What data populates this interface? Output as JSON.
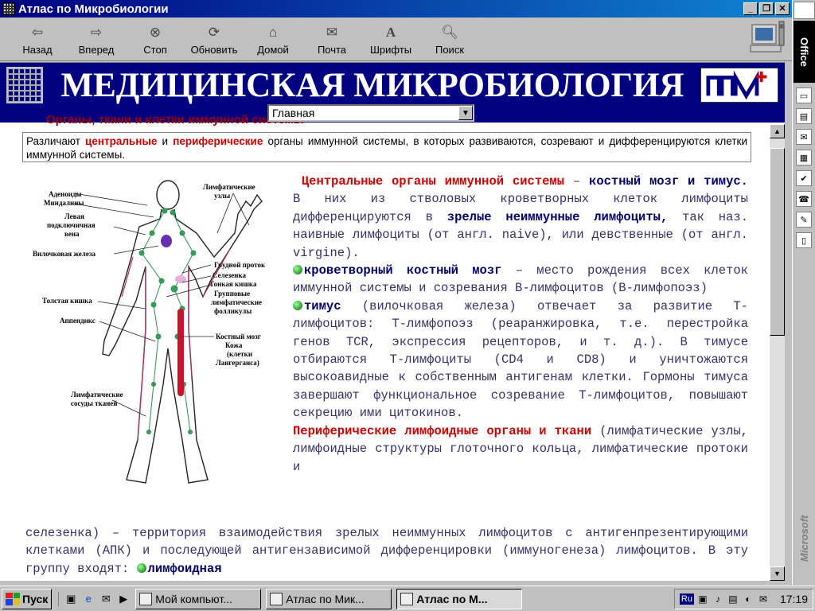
{
  "window": {
    "title": "Атлас по Микробиологии"
  },
  "toolbar": {
    "buttons": [
      {
        "label": "Назад",
        "icon": "arrow-left-icon"
      },
      {
        "label": "Вперед",
        "icon": "arrow-right-icon"
      },
      {
        "label": "Стоп",
        "icon": "stop-icon"
      },
      {
        "label": "Обновить",
        "icon": "refresh-icon"
      },
      {
        "label": "Домой",
        "icon": "home-icon"
      },
      {
        "label": "Почта",
        "icon": "mail-icon"
      },
      {
        "label": "Шрифты",
        "icon": "font-icon"
      },
      {
        "label": "Поиск",
        "icon": "search-icon"
      }
    ]
  },
  "banner": {
    "title": "МЕДИЦИНСКАЯ МИКРОБИОЛОГИЯ"
  },
  "nav": {
    "selected": "Главная"
  },
  "section": {
    "title": "Органы, ткани и клетки иммунной системы"
  },
  "intro": {
    "p1": "Различают ",
    "central": "центральные",
    "p2": " и ",
    "peripheral": "периферические",
    "p3": " органы иммунной системы, в которых развиваются, созревают и дифференцируются клетки иммунной системы."
  },
  "figure": {
    "labels_left": [
      "Аденоиды",
      "Миндалины",
      "Левая",
      "подключичная",
      "вена",
      "Вилочковая железа",
      "Толстая кишка",
      "Аппендикс",
      "Лимфатические",
      "сосуды тканей"
    ],
    "labels_right": [
      "Лимфатические",
      "узлы",
      "Грудной проток",
      "Селезенка",
      "Тонкая кишка",
      "Групповые",
      "лимфатические",
      "фолликулы",
      "Костный мозг",
      "Кожа",
      "(клетки",
      "Лангерганса)"
    ]
  },
  "body": {
    "central_title": "Центральные органы иммунной системы",
    "central_dash": " – ",
    "central_items": "костный мозг и тимус.",
    "central_text": " В них из стволовых кроветворных клеток лимфоциты дифференцируются в ",
    "mature": "зрелые неиммунные лимфоциты,",
    "central_text2": " так наз. наивные лимфоциты (от англ. naive), или девственные (от англ. virgine).",
    "marrow_title": "кроветворный костный мозг",
    "marrow_text": " – место рождения всех клеток иммунной системы и созревания В-лимфоцитов (В-лимфопоэз)",
    "thymus_title": "тимус",
    "thymus_text": " (вилочковая железа) отвечает за развитие Т-лимфоцитов: Т-лимфопоэз (реаранжировка, т.е. перестройка генов TCR, экспрессия рецепторов, и т. д.). В тимусе отбираются Т-лимфоциты (CD4 и CD8) и уничтожаются высокоавидные к собственным антигенам клетки. Гормоны тимуса завершают функциональное созревание Т-лимфоцитов, повышают секрецию ими цитокинов.",
    "peripheral_title": "Периферические лимфоидные органы и ткани",
    "peripheral_text_a": " (лимфатические узлы, лимфоидные структуры глоточного кольца, лимфатические протоки и",
    "peripheral_text_b": "селезенка) – территория взаимодействия зрелых неиммунных лимфоцитов с антигенпрезентирующими клетками (АПК) и последующей антигензависимой дифференцировки (иммуногенеза) лимфоцитов. В эту группу входят: ",
    "lymphoid": "лимфоидная"
  },
  "office": {
    "label": "Office",
    "brand": "Microsoft"
  },
  "taskbar": {
    "start": "Пуск",
    "tasks": [
      "Мой компьют...",
      "Атлас по Мик...",
      "Атлас по М..."
    ],
    "lang": "Ru",
    "clock": "17:19"
  },
  "colors": {
    "title_bar": "#000080",
    "banner": "#000080",
    "accent_red": "#cc0000",
    "text": "#333366"
  }
}
